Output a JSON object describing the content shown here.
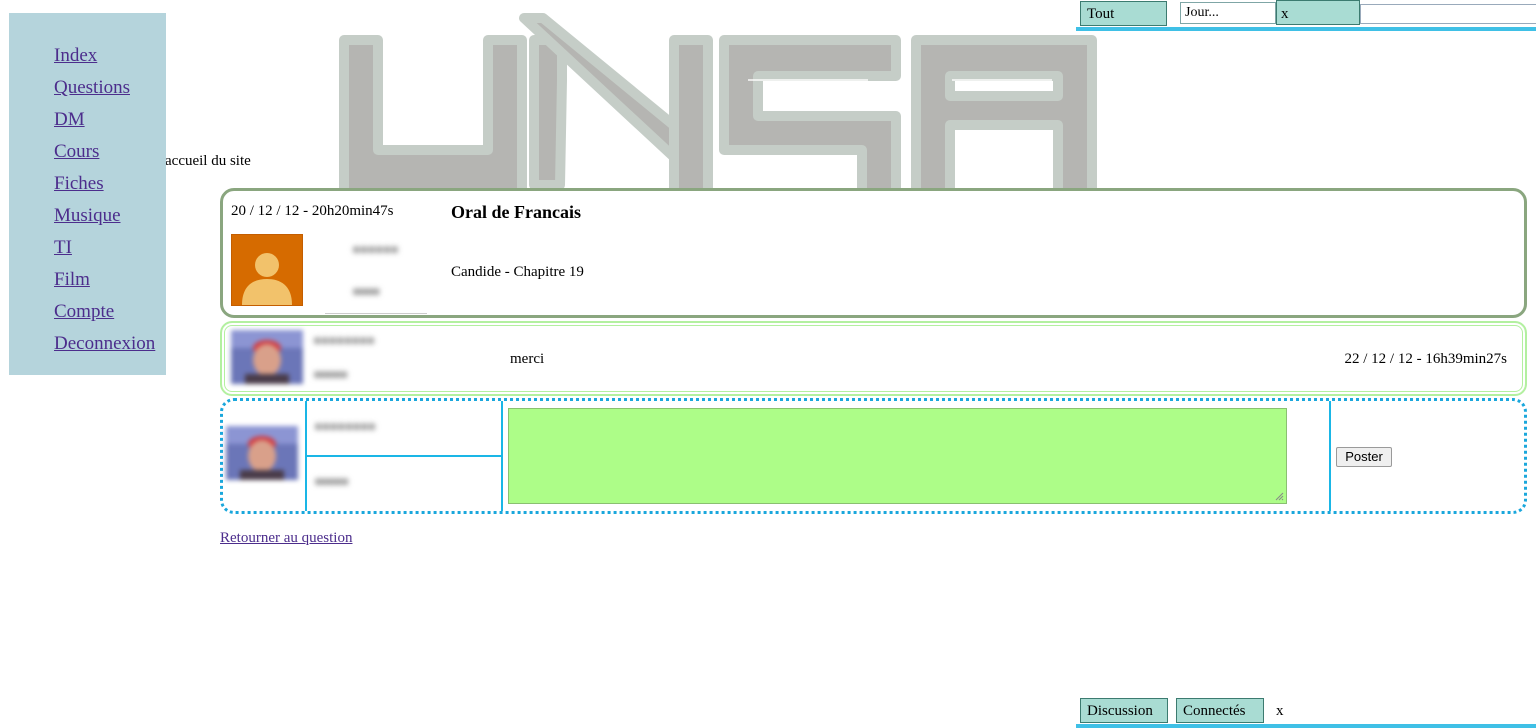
{
  "top_bar": {
    "tab_all": "Tout",
    "day_input_value": "Jour...",
    "close": "x"
  },
  "sidebar": {
    "items": [
      {
        "label": "Index"
      },
      {
        "label": "Questions"
      },
      {
        "label": "DM"
      },
      {
        "label": "Cours"
      },
      {
        "label": "Fiches"
      },
      {
        "label": "Musique"
      },
      {
        "label": "TI"
      },
      {
        "label": "Film"
      },
      {
        "label": "Compte"
      },
      {
        "label": "Deconnexion"
      }
    ]
  },
  "header": {
    "logo_text": "UNSA",
    "home_text": "accueil du site"
  },
  "question": {
    "date": "20 / 12 / 12 - 20h20min47s",
    "title": "Oral de Francais",
    "body": "Candide - Chapitre 19",
    "avatar_icon": "user-silhouette-icon"
  },
  "reply": {
    "message": "merci",
    "date": "22 / 12 / 12 - 16h39min27s"
  },
  "post_form": {
    "button_label": "Poster"
  },
  "back_link": "Retourner au question",
  "bottom_bar": {
    "tab_discussion": "Discussion",
    "tab_connected": "Connectés",
    "close": "x"
  },
  "colors": {
    "sidebar_bg": "#b5d4dc",
    "tab_bg": "#a9dcd3",
    "accent_line": "#3fc0e6",
    "question_border": "#8aa67f",
    "reply_border": "#b3f0a0",
    "textarea_bg": "#adfd88",
    "link": "#4c2d8c"
  }
}
